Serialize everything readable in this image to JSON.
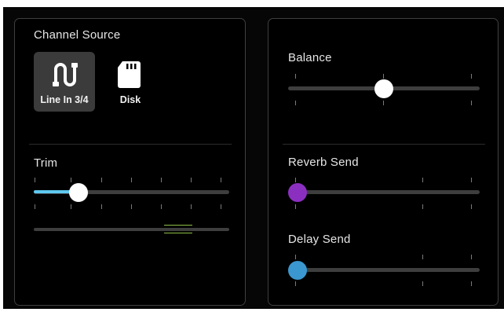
{
  "source": {
    "title": "Channel Source",
    "buttons": [
      {
        "label": "Line In 3/4",
        "icon": "line-in-icon",
        "selected": true
      },
      {
        "label": "Disk",
        "icon": "sd-card-icon",
        "selected": false
      }
    ]
  },
  "trim": {
    "title": "Trim",
    "level_fraction": 0.2
  },
  "balance": {
    "title": "Balance",
    "level_fraction": 0.5
  },
  "reverb_send": {
    "title": "Reverb Send",
    "level_fraction": 0.0,
    "color": "#8b2fc0"
  },
  "delay_send": {
    "title": "Delay Send",
    "level_fraction": 0.0,
    "color": "#3b97cf"
  },
  "colors": {
    "accent": "#5ec8f0",
    "knob": "#ffffff",
    "meter": "#8dbe47"
  }
}
